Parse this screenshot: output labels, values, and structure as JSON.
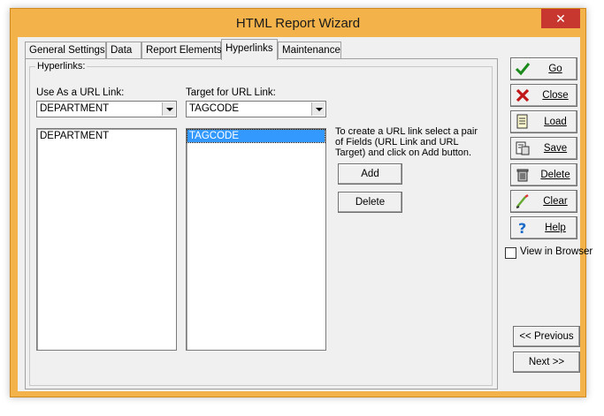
{
  "window": {
    "title": "HTML Report Wizard",
    "close_glyph": "✕"
  },
  "tabs": [
    {
      "label": "General Settings"
    },
    {
      "label": "Data"
    },
    {
      "label": "Report Elements"
    },
    {
      "label": "Hyperlinks",
      "active": true
    },
    {
      "label": "Maintenance"
    }
  ],
  "hyperlinks": {
    "group_label": "Hyperlinks:",
    "url_link_label": "Use As a URL Link:",
    "url_link_value": "DEPARTMENT",
    "target_label": "Target for URL Link:",
    "target_value": "TAGCODE",
    "link_list": [
      "DEPARTMENT"
    ],
    "target_list": [
      "TAGCODE"
    ],
    "help_text": "To create a URL link select a pair of Fields (URL Link and URL Target) and click on Add button.",
    "add_label": "Add",
    "delete_label": "Delete"
  },
  "side": {
    "go": "Go",
    "close": "Close",
    "load": "Load",
    "save": "Save",
    "delete": "Delete",
    "clear": "Clear",
    "help": "Help",
    "view_in_browser": "View in Browser",
    "previous": "<< Previous",
    "next": "Next >>"
  },
  "colors": {
    "title_bar": "#f4b34a",
    "close_button": "#c7372f",
    "selection": "#3399ff"
  }
}
